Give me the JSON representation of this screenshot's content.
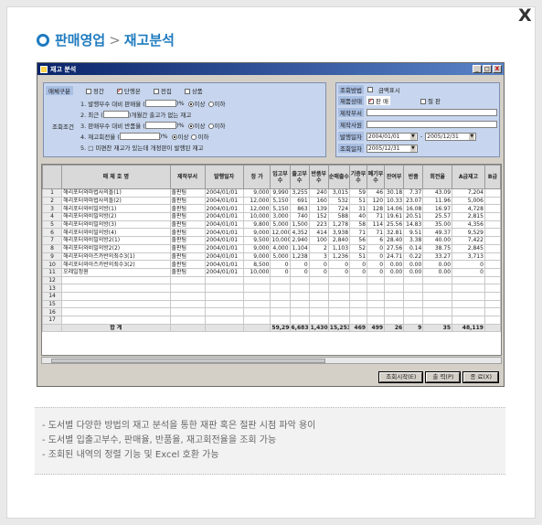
{
  "close_glyph": "X",
  "header": {
    "section": "판매영업",
    "separator": ">",
    "page": "재고분석"
  },
  "window": {
    "title": "재고 분석",
    "controls": [
      "_",
      "□",
      "X"
    ]
  },
  "filters": {
    "category_label": "매체구분",
    "categories": [
      {
        "label": "정간",
        "checked": false
      },
      {
        "label": "단행본",
        "checked": true
      },
      {
        "label": "전집",
        "checked": false
      },
      {
        "label": "상품",
        "checked": false
      }
    ],
    "conditions_label": "조회조건",
    "conditions": [
      {
        "text": "1. 발행부수 대비 판매율 (",
        "suffix": ")%",
        "opt1": "이상",
        "opt2": "이하",
        "selected": "opt1"
      },
      {
        "text": "2. 최근 (",
        "suffix": ")개월간 출고가 없는 재고",
        "opt1": "",
        "opt2": "",
        "selected": ""
      },
      {
        "text": "3. 판매부수 대비 반품율 (",
        "suffix": ")%",
        "opt1": "이상",
        "opt2": "이하",
        "selected": "opt1"
      },
      {
        "text": "4. 재고회전율 (",
        "suffix": ")%",
        "opt1": "이상",
        "opt2": "이하",
        "selected": "opt1"
      },
      {
        "text": "5. □ 미편찬 재고가 있는데 개정판이 발행된 재고",
        "suffix": "",
        "opt1": "",
        "opt2": "",
        "selected": ""
      }
    ]
  },
  "right_panel": {
    "view_method_label": "조회방법",
    "amount_display_label": "금액표시",
    "product_status_label": "제품상태",
    "status_on_label": "판 매",
    "status_off_label": "절 판",
    "dept_label": "제작부서",
    "staff_label": "제작사원",
    "pub_date_label": "발행일자",
    "pub_date_from": "2004/01/01",
    "pub_date_sep": "-",
    "pub_date_to": "2005/12/31",
    "query_date_label": "조회일자",
    "query_date": "2005/12/31"
  },
  "table": {
    "columns": [
      "",
      "매 체 호 명",
      "제작부서",
      "발행일자",
      "정 가",
      "입고부수",
      "출고부수",
      "반품부수",
      "순매출수",
      "기증부수",
      "폐기부수",
      "잔여부",
      "반품",
      "회전율",
      "A급재고",
      "B급"
    ],
    "rows": [
      [
        "1",
        "해리포터와마법사의돌(1)",
        "출판팀",
        "2004/01/01",
        "9,000",
        "9,990",
        "3,255",
        "240",
        "3,015",
        "59",
        "46",
        "30.18",
        "7.37",
        "43.09",
        "7,204",
        ""
      ],
      [
        "2",
        "해리포터와마법사의돌(2)",
        "출판팀",
        "2004/01/01",
        "12,000",
        "5,150",
        "691",
        "160",
        "532",
        "51",
        "120",
        "10.33",
        "23.07",
        "11.96",
        "5,006",
        ""
      ],
      [
        "3",
        "해리포터와비밀의방(1)",
        "출판팀",
        "2004/01/01",
        "12,000",
        "5,150",
        "863",
        "139",
        "724",
        "31",
        "128",
        "14.06",
        "16.08",
        "16.97",
        "4,728",
        ""
      ],
      [
        "4",
        "해리포터와비밀의방(2)",
        "출판팀",
        "2004/01/01",
        "10,000",
        "3,000",
        "740",
        "152",
        "588",
        "40",
        "71",
        "19.61",
        "20.51",
        "25.57",
        "2,815",
        ""
      ],
      [
        "5",
        "해리포터와비밀의방(3)",
        "출판팀",
        "2004/01/01",
        "9,800",
        "5,000",
        "1,500",
        "223",
        "1,278",
        "58",
        "114",
        "25.56",
        "14.83",
        "35.00",
        "4,356",
        ""
      ],
      [
        "6",
        "해리포터와비밀의방(4)",
        "출판팀",
        "2004/01/01",
        "9,000",
        "12,000",
        "4,352",
        "414",
        "3,938",
        "71",
        "71",
        "32.81",
        "9.51",
        "49.37",
        "9,529",
        ""
      ],
      [
        "7",
        "해리포터와비밀의방2(1)",
        "출판팀",
        "2004/01/01",
        "9,500",
        "10,000",
        "2,940",
        "100",
        "2,840",
        "56",
        "6",
        "28.40",
        "3.38",
        "40.00",
        "7,422",
        ""
      ],
      [
        "8",
        "해리포터와비밀의방2(2)",
        "출판팀",
        "2004/01/01",
        "9,000",
        "4,000",
        "1,104",
        "2",
        "1,103",
        "52",
        "0",
        "27.56",
        "0.14",
        "38.75",
        "2,845",
        ""
      ],
      [
        "9",
        "해리포터와아즈카반의죄수3(1)",
        "출판팀",
        "2004/01/01",
        "9,000",
        "5,000",
        "1,238",
        "3",
        "1,236",
        "51",
        "0",
        "24.71",
        "0.22",
        "33.27",
        "3,713",
        ""
      ],
      [
        "10",
        "해리포터와아즈카반의죄수3(2)",
        "출판팀",
        "2004/01/01",
        "8,500",
        "0",
        "0",
        "0",
        "0",
        "0",
        "0",
        "0.00",
        "0.00",
        "0.00",
        "0",
        ""
      ],
      [
        "11",
        "오레일정원",
        "출판팀",
        "2004/01/01",
        "10,000",
        "0",
        "0",
        "0",
        "0",
        "0",
        "0",
        "0.00",
        "0.00",
        "0.00",
        "0",
        ""
      ],
      [
        "12",
        "",
        "",
        "",
        "",
        "",
        "",
        "",
        "",
        "",
        "",
        "",
        "",
        "",
        "",
        ""
      ],
      [
        "13",
        "",
        "",
        "",
        "",
        "",
        "",
        "",
        "",
        "",
        "",
        "",
        "",
        "",
        "",
        ""
      ],
      [
        "14",
        "",
        "",
        "",
        "",
        "",
        "",
        "",
        "",
        "",
        "",
        "",
        "",
        "",
        "",
        ""
      ],
      [
        "15",
        "",
        "",
        "",
        "",
        "",
        "",
        "",
        "",
        "",
        "",
        "",
        "",
        "",
        "",
        ""
      ],
      [
        "16",
        "",
        "",
        "",
        "",
        "",
        "",
        "",
        "",
        "",
        "",
        "",
        "",
        "",
        "",
        ""
      ],
      [
        "17",
        "",
        "",
        "",
        "",
        "",
        "",
        "",
        "",
        "",
        "",
        "",
        "",
        "",
        "",
        ""
      ]
    ],
    "total": [
      "",
      "합 계",
      "",
      "",
      "",
      "59,290",
      "6,683",
      "1,430",
      "15,253",
      "469",
      "499",
      "26",
      "9",
      "35",
      "48,119",
      ""
    ]
  },
  "buttons": {
    "query": "조회시작(E)",
    "print": "출 력(P)",
    "close": "종 료(X)"
  },
  "description": [
    "- 도서별 다양한 방법의 재고 분석을 통한 재판 혹은 절판 시점 파악 용이",
    "- 도서별 입출고부수, 판매율, 반품율, 재고회전율을 조회 가능",
    "- 조회된 내역의 정렬 기능 및 Excel 호환 가능"
  ],
  "colors": {
    "accent": "#1f7bbf",
    "panel": "#c7d6ee",
    "window": "#d4d0c8"
  }
}
